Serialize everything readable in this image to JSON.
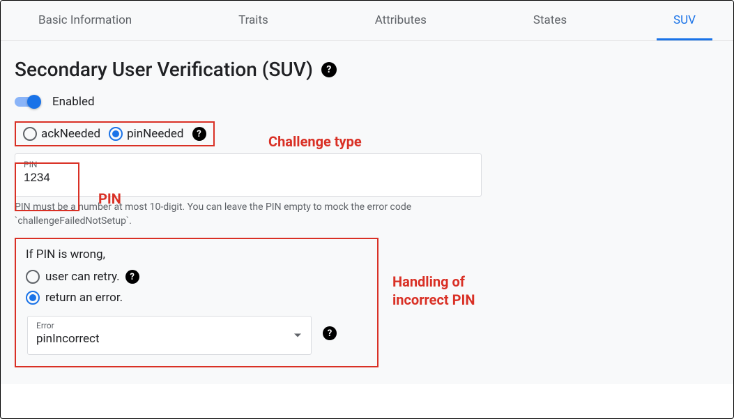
{
  "tabs": [
    {
      "label": "Basic Information"
    },
    {
      "label": "Traits"
    },
    {
      "label": "Attributes"
    },
    {
      "label": "States"
    },
    {
      "label": "SUV"
    }
  ],
  "page": {
    "title": "Secondary User Verification (SUV)"
  },
  "toggle": {
    "label": "Enabled"
  },
  "challenge": {
    "ackNeeded": "ackNeeded",
    "pinNeeded": "pinNeeded"
  },
  "pinField": {
    "label": "PIN",
    "value": "1234",
    "hint": "PIN must be a number at most 10-digit. You can leave the PIN empty to mock the error code `challengeFailedNotSetup`."
  },
  "wrongPin": {
    "title": "If PIN is wrong,",
    "retry": "user can retry.",
    "returnError": "return an error.",
    "errorSelect": {
      "label": "Error",
      "value": "pinIncorrect"
    }
  },
  "annotations": {
    "challengeType": "Challenge type",
    "pin": "PIN",
    "incorrectHandling": "Handling of\nincorrect PIN"
  }
}
